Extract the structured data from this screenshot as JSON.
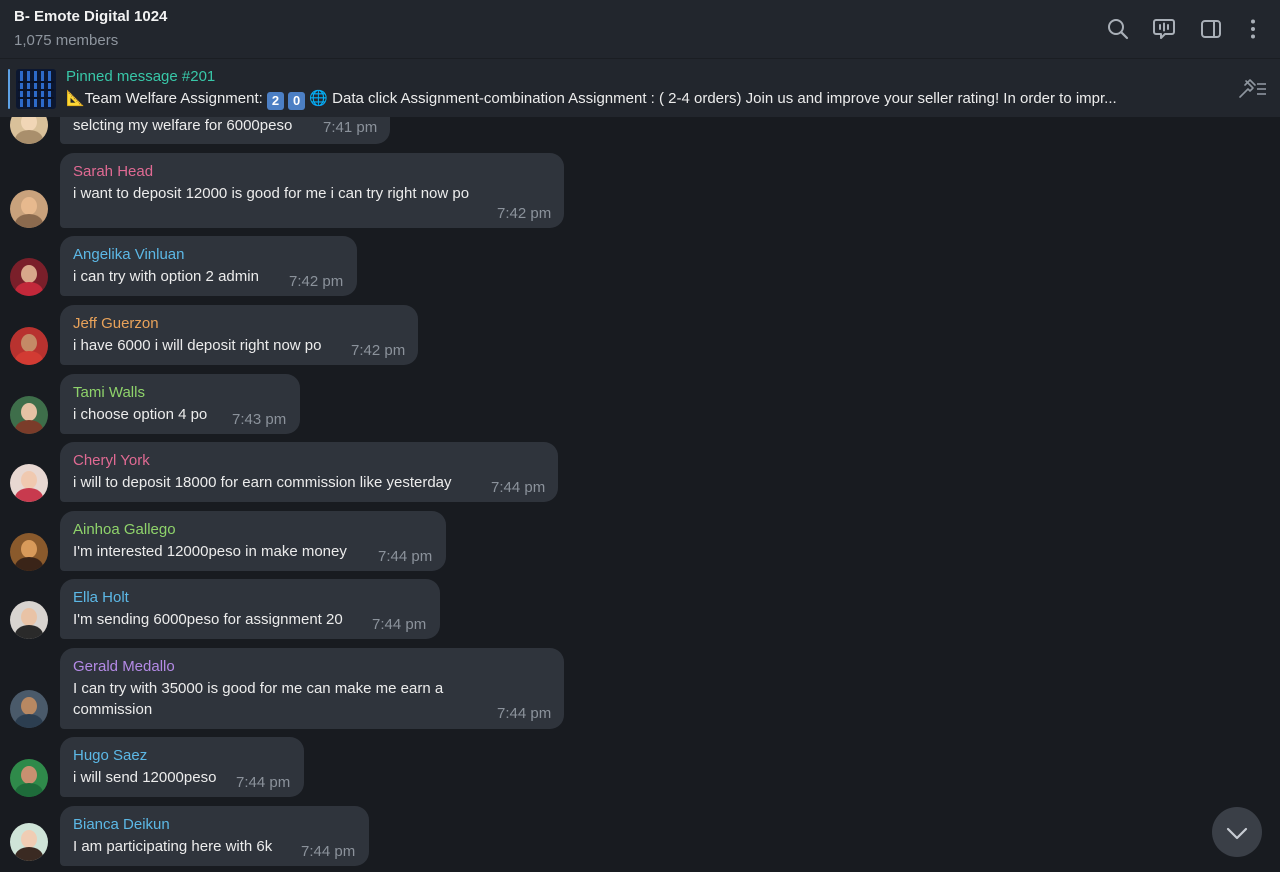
{
  "header": {
    "title": "B- Emote Digital 1024",
    "subtitle": "1,075 members",
    "icons": [
      "search-icon",
      "live-stream-icon",
      "sidebar-toggle-icon",
      "more-options-icon"
    ]
  },
  "pinned": {
    "title": "Pinned message #201",
    "text_prefix": "📐Team Welfare Assignment: ",
    "digit1": "2",
    "digit2": "0",
    "globe": "🌐",
    "text_suffix": " Data click Assignment-combination Assignment : ( 2-4 orders)   Join us and improve your seller rating! In order to impr..."
  },
  "colors": {
    "background": "#181b20",
    "header": "#22262d",
    "bubble": "#2f343c",
    "pinned_accent": "#38c7a8",
    "time": "#8b929b"
  },
  "messages": [
    {
      "sender": "",
      "text": "selcting my  welfare for 6000peso",
      "time": "7:41 pm",
      "color": "#e8e8e8"
    },
    {
      "sender": "Sarah Head",
      "text": "i want to deposit 12000 is good for me i can try right now po",
      "time": "7:42 pm",
      "color": "#e06a93"
    },
    {
      "sender": "Angelika Vinluan",
      "text": "i can try with option 2 admin",
      "time": "7:42 pm",
      "color": "#5cb8e6"
    },
    {
      "sender": "Jeff Guerzon",
      "text": "i have 6000 i will deposit right now po",
      "time": "7:42 pm",
      "color": "#e8a25a"
    },
    {
      "sender": "Tami Walls",
      "text": "i choose option 4 po",
      "time": "7:43 pm",
      "color": "#8fd36b"
    },
    {
      "sender": "Cheryl York",
      "text": "i will to deposit 18000 for earn commission like yesterday",
      "time": "7:44 pm",
      "color": "#e06a93"
    },
    {
      "sender": "Ainhoa Gallego",
      "text": "I'm interested 12000peso in make money",
      "time": "7:44 pm",
      "color": "#8fd36b"
    },
    {
      "sender": "Ella Holt",
      "text": "I'm sending 6000peso for assignment 20",
      "time": "7:44 pm",
      "color": "#5cb8e6"
    },
    {
      "sender": "Gerald Medallo",
      "text": "I can try with 35000 is good for me can make me earn a",
      "text2": "commission",
      "time": "7:44 pm",
      "color": "#b48ae6"
    },
    {
      "sender": "Hugo Saez",
      "text": "i will send 12000peso",
      "time": "7:44 pm",
      "color": "#5cb8e6"
    },
    {
      "sender": "Bianca Deikun",
      "text": "I am participating here with 6k",
      "time": "7:44 pm",
      "color": "#5cb8e6"
    }
  ],
  "scroll_button_icon": "chevron-down-icon"
}
